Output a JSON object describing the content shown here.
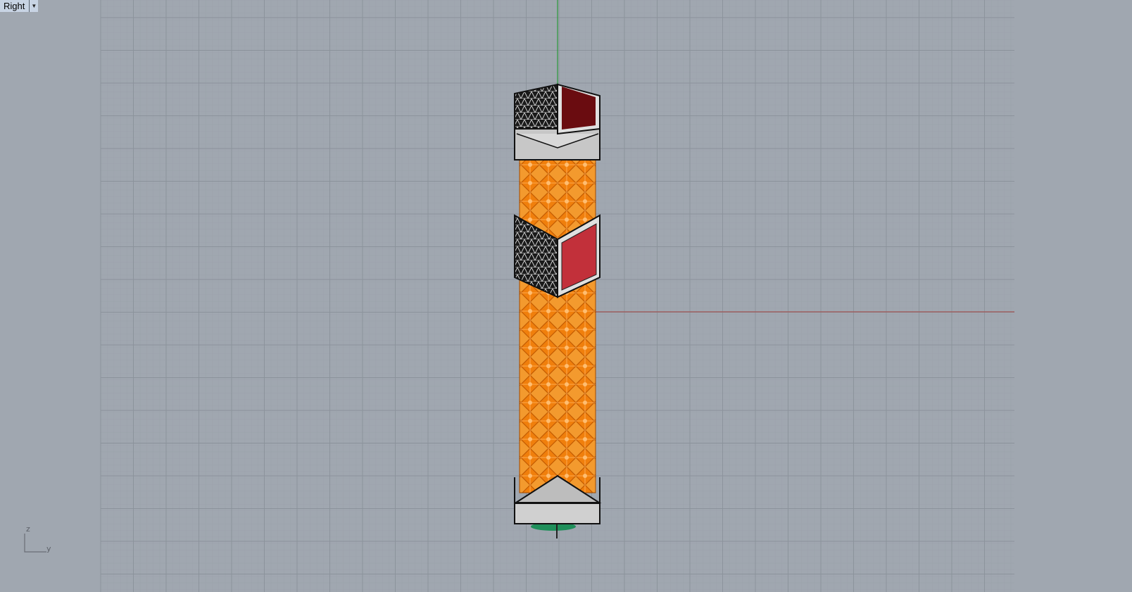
{
  "viewport": {
    "name": "Right",
    "dropdown_icon": "chevron-down-icon"
  },
  "axis_widget": {
    "vertical_label": "z",
    "horizontal_label": "y"
  },
  "colors": {
    "background": "#a0a7b0",
    "grid_minor": "#959ca5",
    "grid_major": "#8a919a",
    "x_axis": "#a05454",
    "z_axis": "#2a9a3a",
    "lattice": "#f28a1a",
    "panel_dark_red": "#6a0c10",
    "panel_red": "#c2303a",
    "frame": "#c0c0c0"
  }
}
